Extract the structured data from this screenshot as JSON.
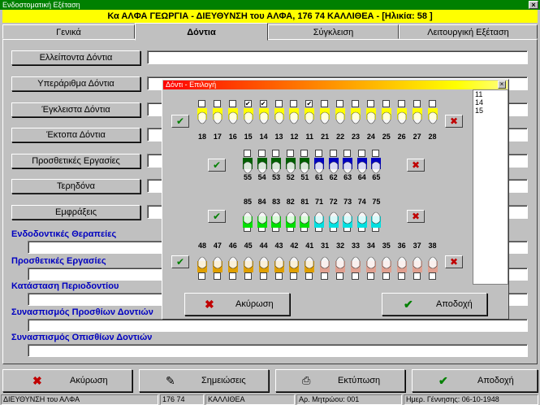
{
  "window": {
    "title": "Ενδοστοματική Εξέταση"
  },
  "patient_bar": "Κα ΑΛΦΑ ΓΕΩΡΓΙΑ - ΔΙΕΥΘΥΝΣΗ του ΑΛΦΑ, 176 74 ΚΑΛΛΙΘΕΑ - [Ηλικία: 58 ]",
  "tabs": [
    {
      "label": "Γενικά"
    },
    {
      "label": "Δόντια"
    },
    {
      "label": "Σύγκλειση"
    },
    {
      "label": "Λειτουργική Εξέταση"
    }
  ],
  "rows": [
    {
      "label": "Ελλείποντα Δόντια"
    },
    {
      "label": "Υπεράριθμα Δόντια"
    },
    {
      "label": "Έγκλειστα Δόντια"
    },
    {
      "label": "Έκτοπα Δόντια"
    },
    {
      "label": "Προσθετικές Εργασίες"
    },
    {
      "label": "Τερηδόνα"
    },
    {
      "label": "Εμφράξεις"
    }
  ],
  "sections": [
    {
      "label": "Ενδοδοντικές Θεραπείες"
    },
    {
      "label": "Προσθετικές Εργασίες"
    },
    {
      "label": "Κατάσταση Περιοδοντίου"
    },
    {
      "label": "Συνασπισμός Προσθίων Δοντιών"
    },
    {
      "label": "Συνασπισμός Οπισθίων Δοντιών"
    }
  ],
  "dialog": {
    "title": "Δόντι - Επιλογή",
    "upper_permanent": [
      "18",
      "17",
      "16",
      "15",
      "14",
      "13",
      "12",
      "11",
      "21",
      "22",
      "23",
      "24",
      "25",
      "26",
      "27",
      "28"
    ],
    "upper_checked": [
      "15",
      "14",
      "11"
    ],
    "upper_primary": [
      "55",
      "54",
      "53",
      "52",
      "51",
      "61",
      "62",
      "63",
      "64",
      "65"
    ],
    "lower_primary": [
      "85",
      "84",
      "83",
      "82",
      "81",
      "71",
      "72",
      "73",
      "74",
      "75"
    ],
    "lower_permanent": [
      "48",
      "47",
      "46",
      "45",
      "44",
      "43",
      "42",
      "41",
      "31",
      "32",
      "33",
      "34",
      "35",
      "36",
      "37",
      "38"
    ],
    "selected_list": [
      "11",
      "14",
      "15"
    ],
    "cancel_label": "Ακύρωση",
    "accept_label": "Αποδοχή"
  },
  "bottom_buttons": {
    "cancel": "Ακύρωση",
    "notes": "Σημειώσεις",
    "print": "Εκτύπωση",
    "accept": "Αποδοχή"
  },
  "status": {
    "address": "ΔΙΕΥΘΥΝΣΗ του ΑΛΦΑ",
    "zip": "176 74",
    "city": "ΚΑΛΛΙΘΕΑ",
    "record": "Αρ. Μητρώου: 001",
    "birth": "Ημερ. Γέννησης: 06-10-1948"
  },
  "colors": {
    "upper_perm": "#ffff00",
    "upper_prim": "#006000",
    "upper_prim2": "#0000c0",
    "lower_prim": "#00e000",
    "lower_prim2": "#00e0e0",
    "lower_perm": "#e0a000",
    "lower_perm2": "#e0a090"
  }
}
